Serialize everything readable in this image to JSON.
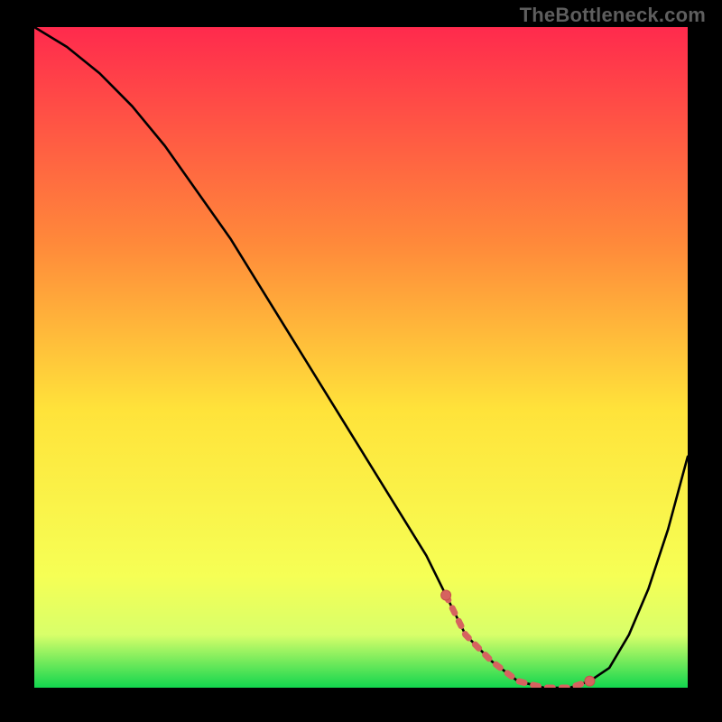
{
  "watermark": "TheBottleneck.com",
  "colors": {
    "frame": "#000000",
    "curve": "#000000",
    "marker_fill": "#d6635f",
    "marker_stroke": "#c64f4b",
    "grad_top": "#ff2a4d",
    "grad_mid1": "#ff8a3a",
    "grad_mid2": "#ffe33a",
    "grad_low1": "#f6ff55",
    "grad_low2": "#d8ff6a",
    "grad_bottom": "#12d64e"
  },
  "chart_data": {
    "type": "line",
    "title": "",
    "xlabel": "",
    "ylabel": "",
    "xlim": [
      0,
      100
    ],
    "ylim": [
      0,
      100
    ],
    "series": [
      {
        "name": "bottleneck-curve",
        "x": [
          0,
          5,
          10,
          15,
          20,
          25,
          30,
          35,
          40,
          45,
          50,
          55,
          60,
          63,
          66,
          70,
          74,
          78,
          82,
          85,
          88,
          91,
          94,
          97,
          100
        ],
        "y": [
          100,
          97,
          93,
          88,
          82,
          75,
          68,
          60,
          52,
          44,
          36,
          28,
          20,
          14,
          8,
          4,
          1,
          0,
          0,
          1,
          3,
          8,
          15,
          24,
          35
        ]
      }
    ],
    "highlight_segment": {
      "name": "optimal-range",
      "x": [
        63,
        66,
        70,
        74,
        78,
        82,
        85
      ],
      "y": [
        14,
        8,
        4,
        1,
        0,
        0,
        1
      ]
    }
  }
}
